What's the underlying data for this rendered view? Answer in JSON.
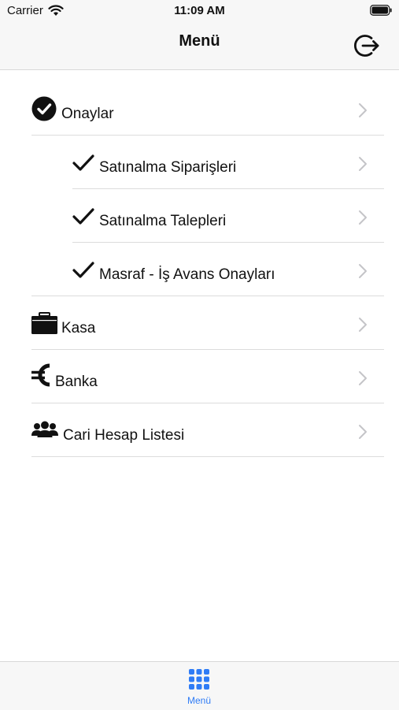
{
  "status_bar": {
    "carrier": "Carrier",
    "time": "11:09 AM"
  },
  "nav": {
    "title": "Menü",
    "logout_icon": "logout-icon"
  },
  "menu": {
    "items": [
      {
        "label": "Onaylar",
        "icon": "check-circle-icon"
      },
      {
        "label": "Satınalma Siparişleri",
        "icon": "checkmark-icon"
      },
      {
        "label": "Satınalma Talepleri",
        "icon": "checkmark-icon"
      },
      {
        "label": "Masraf - İş Avans Onayları",
        "icon": "checkmark-icon"
      },
      {
        "label": "Kasa",
        "icon": "cash-box-icon"
      },
      {
        "label": "Banka",
        "icon": "euro-icon"
      },
      {
        "label": "Cari Hesap Listesi",
        "icon": "users-icon"
      }
    ]
  },
  "tab_bar": {
    "tabs": [
      {
        "label": "Menü",
        "icon": "grid-icon",
        "selected": true
      }
    ]
  },
  "colors": {
    "accent": "#2f7cf6",
    "bar_background": "#f7f7f7",
    "separator": "#dcdcdc",
    "chevron": "#c4c4c8"
  }
}
